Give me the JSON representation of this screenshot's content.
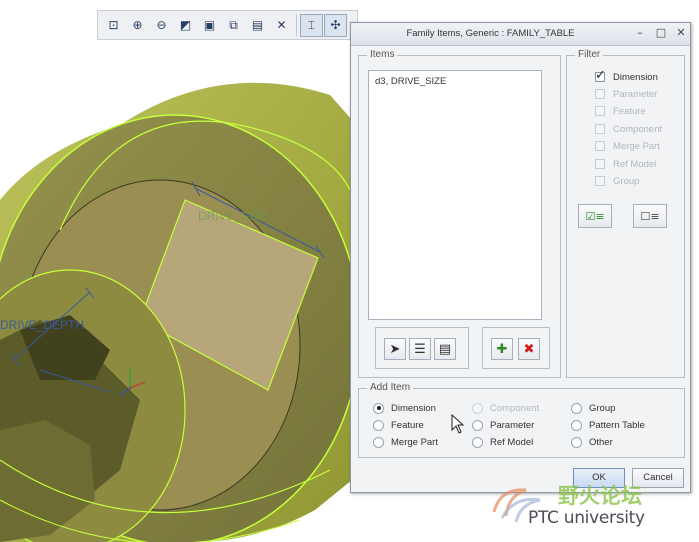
{
  "viewport": {
    "dimension_labels": [
      "DRIVE_SIZE",
      "DRIVE_DEPTH"
    ]
  },
  "toolbar": {
    "buttons": [
      {
        "name": "zoom-fit-icon",
        "glyph": "⊡"
      },
      {
        "name": "zoom-in-icon",
        "glyph": "⊕"
      },
      {
        "name": "zoom-out-icon",
        "glyph": "⊖"
      },
      {
        "name": "refit-icon",
        "glyph": "◩"
      },
      {
        "name": "display-style-icon",
        "glyph": "▣"
      },
      {
        "name": "saved-views-icon",
        "glyph": "⧉"
      },
      {
        "name": "view-manager-icon",
        "glyph": "▤"
      },
      {
        "name": "datum-display-icon",
        "glyph": "✕"
      },
      {
        "name": "annotation-display-icon",
        "glyph": "⌶"
      },
      {
        "name": "spin-center-icon",
        "glyph": "✣"
      }
    ]
  },
  "dialog": {
    "title": "Family Items,  Generic : FAMILY_TABLE",
    "items_label": "Items",
    "items": [
      "d3, DRIVE_SIZE"
    ],
    "filter": {
      "label": "Filter",
      "options": [
        {
          "label": "Dimension",
          "checked": true,
          "enabled": true
        },
        {
          "label": "Parameter",
          "checked": false,
          "enabled": false
        },
        {
          "label": "Feature",
          "checked": false,
          "enabled": false
        },
        {
          "label": "Component",
          "checked": false,
          "enabled": false
        },
        {
          "label": "Merge Part",
          "checked": false,
          "enabled": false
        },
        {
          "label": "Ref Model",
          "checked": false,
          "enabled": false
        },
        {
          "label": "Group",
          "checked": false,
          "enabled": false
        }
      ]
    },
    "add_item": {
      "label": "Add Item",
      "options": [
        {
          "label": "Dimension",
          "selected": true,
          "enabled": true
        },
        {
          "label": "Component",
          "selected": false,
          "enabled": false
        },
        {
          "label": "Group",
          "selected": false,
          "enabled": true
        },
        {
          "label": "Feature",
          "selected": false,
          "enabled": true
        },
        {
          "label": "Parameter",
          "selected": false,
          "enabled": true
        },
        {
          "label": "Pattern Table",
          "selected": false,
          "enabled": true
        },
        {
          "label": "Merge Part",
          "selected": false,
          "enabled": true
        },
        {
          "label": "Ref Model",
          "selected": false,
          "enabled": true
        },
        {
          "label": "Other",
          "selected": false,
          "enabled": true
        }
      ]
    },
    "ok_label": "OK",
    "cancel_label": "Cancel"
  },
  "watermark": {
    "text": "PTC university",
    "cn_text": "野火论坛"
  },
  "colors": {
    "model_fill": "#a7ae45",
    "model_edge": "#c6ff3c",
    "dimension_text": "#3a5a9c",
    "add_icon": "#2f8a2a",
    "delete_icon": "#d21e1e"
  }
}
